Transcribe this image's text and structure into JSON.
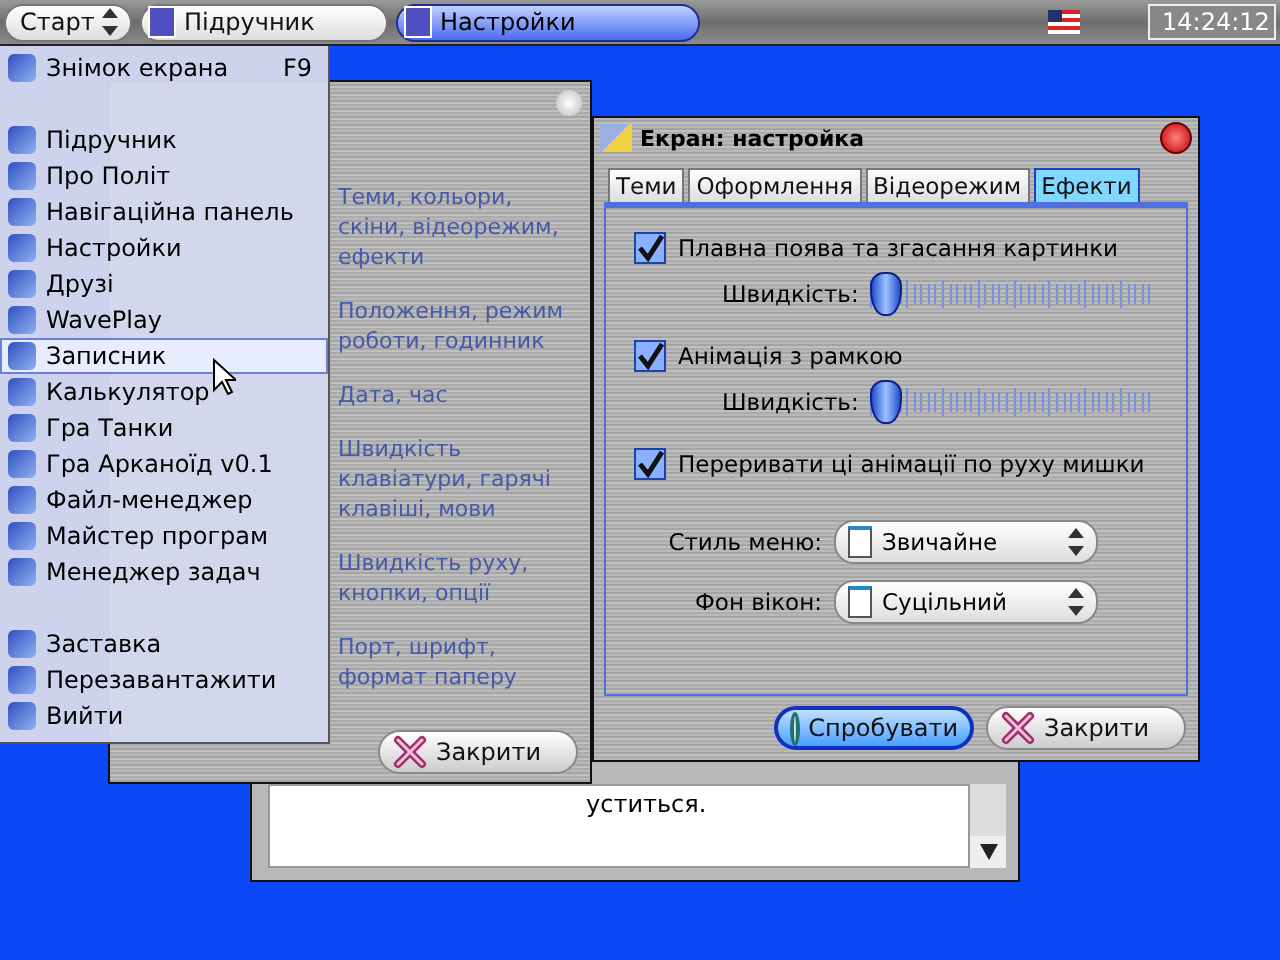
{
  "taskbar": {
    "start": {
      "label": "Старт"
    },
    "tasks": [
      {
        "label": "Підручник",
        "selected": false
      },
      {
        "label": "Настройки",
        "selected": true
      }
    ],
    "clock": "14:24:12"
  },
  "start_menu": {
    "groups": [
      {
        "items": [
          {
            "label": "Знімок екрана",
            "shortcut": "F9",
            "selected": false
          }
        ]
      },
      {
        "items": [
          {
            "label": "Підручник",
            "selected": false
          },
          {
            "label": "Про Політ",
            "selected": false
          },
          {
            "label": "Навігаційна панель",
            "selected": false
          },
          {
            "label": "Настройки",
            "selected": false
          },
          {
            "label": "Друзі",
            "selected": false
          },
          {
            "label": "WavePlay",
            "selected": false
          },
          {
            "label": "Записник",
            "selected": true
          },
          {
            "label": "Калькулятор",
            "selected": false
          },
          {
            "label": "Гра Танки",
            "selected": false
          },
          {
            "label": "Гра Арканоїд v0.1",
            "selected": false
          },
          {
            "label": "Файл-менеджер",
            "selected": false
          },
          {
            "label": "Майстер програм",
            "selected": false
          },
          {
            "label": "Менеджер задач",
            "selected": false
          }
        ]
      },
      {
        "items": [
          {
            "label": "Заставка",
            "selected": false
          },
          {
            "label": "Перезавантажити",
            "selected": false
          },
          {
            "label": "Вийти",
            "selected": false
          }
        ]
      }
    ]
  },
  "settings_window": {
    "descriptions": [
      "Теми, кольори, скіни, відеорежим, ефекти",
      "Положення, режим роботи, годинник",
      "Дата, час",
      "Швидкість клавіатури, гарячі клавіші, мови",
      "Швидкість руху, кнопки, опції",
      "Порт, шрифт, формат паперу"
    ],
    "close_button": "Закрити"
  },
  "effects_dialog": {
    "title": "Екран: настройка",
    "tabs": [
      {
        "label": "Теми",
        "selected": false
      },
      {
        "label": "Оформлення",
        "selected": false
      },
      {
        "label": "Відеорежим",
        "selected": false
      },
      {
        "label": "Ефекти",
        "selected": true
      }
    ],
    "options": [
      {
        "label": "Плавна поява та згасання картинки",
        "checked": true,
        "speed_label": "Швидкість:",
        "level": 0
      },
      {
        "label": "Анімація з рамкою",
        "checked": true,
        "speed_label": "Швидкість:",
        "level": 0
      },
      {
        "label": "Переривати ці анімації по руху мишки",
        "checked": true
      }
    ],
    "selects": [
      {
        "label": "Стиль меню:",
        "value": "Звичайне"
      },
      {
        "label": "Фон вікон:",
        "value": "Суцільний"
      }
    ],
    "buttons": [
      {
        "label": "Спробувати",
        "kind": "try"
      },
      {
        "label": "Закрити",
        "kind": "close"
      }
    ]
  },
  "notes_window": {
    "text": "уститься."
  }
}
